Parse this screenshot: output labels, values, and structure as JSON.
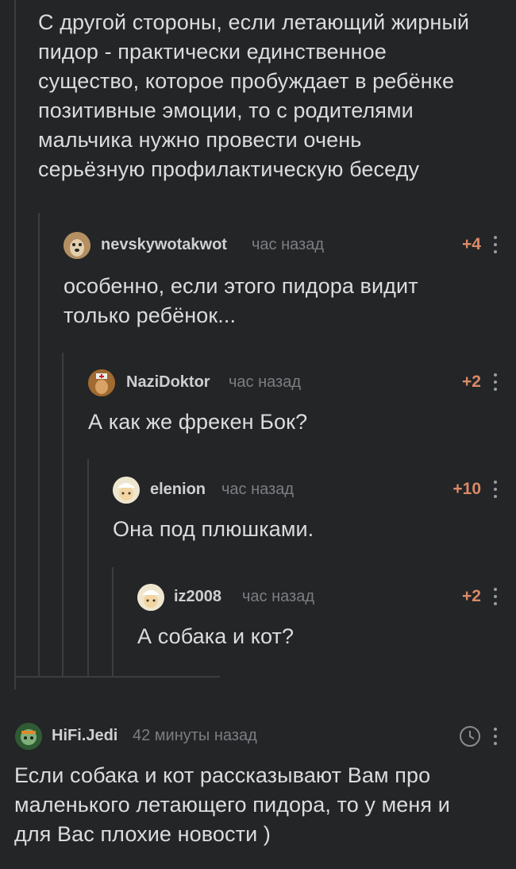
{
  "top_comment": {
    "lines": [
      "С другой стороны, если летающий жирный",
      "пидор - практически единственное",
      "существо, которое пробуждает в ребёнке",
      "позитивные эмоции, то с родителями",
      "мальчика нужно провести очень",
      "серьёзную профилактическую беседу"
    ]
  },
  "replies": [
    {
      "user": "nevskywotakwot",
      "time": "час назад",
      "score": "+4",
      "lines": [
        "особенно, если этого пидора видит",
        "только ребёнок..."
      ]
    },
    {
      "user": "NaziDoktor",
      "time": "час назад",
      "score": "+2",
      "lines": [
        "А как же фрекен Бок?"
      ]
    },
    {
      "user": "elenion",
      "time": "час назад",
      "score": "+10",
      "lines": [
        "Она под плюшками."
      ]
    },
    {
      "user": "iz2008",
      "time": "час назад",
      "score": "+2",
      "lines": [
        "А собака и кот?"
      ]
    }
  ],
  "bottom_comment": {
    "user": "HiFi.Jedi",
    "time": "42 минуты назад",
    "lines": [
      "Если собака и кот рассказывают Вам про",
      "маленького летающего пидора, то у меня и",
      "для Вас плохие новости )"
    ]
  },
  "icons": {
    "more": "more-vertical-icon",
    "clock": "clock-icon",
    "avatar": "user-avatar-icon"
  },
  "colors": {
    "background": "#232527",
    "text": "#dcdcdc",
    "score": "#d98a67",
    "meta": "#7b7e82",
    "thread_line": "#3b3e41"
  }
}
